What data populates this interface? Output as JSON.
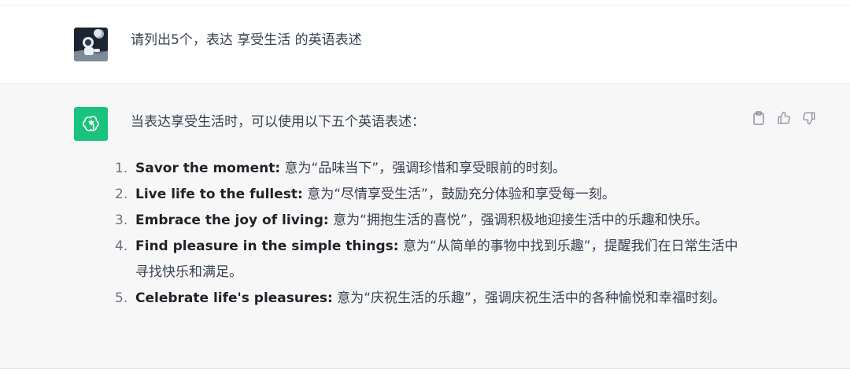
{
  "conversation": {
    "user_message": "请列出5个，表达 享受生活 的英语表述",
    "assistant_intro": "当表达享受生活时，可以使用以下五个英语表述：",
    "answers": [
      {
        "num": "1.",
        "phrase": "Savor the moment:",
        "desc": " 意为“品味当下”，强调珍惜和享受眼前的时刻。"
      },
      {
        "num": "2.",
        "phrase": "Live life to the fullest:",
        "desc": " 意为“尽情享受生活”，鼓励充分体验和享受每一刻。"
      },
      {
        "num": "3.",
        "phrase": "Embrace the joy of living:",
        "desc": " 意为“拥抱生活的喜悦”，强调积极地迎接生活中的乐趣和快乐。"
      },
      {
        "num": "4.",
        "phrase": "Find pleasure in the simple things:",
        "desc": " 意为“从简单的事物中找到乐趣”，提醒我们在日常生活中寻找快乐和满足。"
      },
      {
        "num": "5.",
        "phrase": "Celebrate life's pleasures:",
        "desc": " 意为“庆祝生活的乐趣”，强调庆祝生活中的各种愉悦和幸福时刻。"
      }
    ]
  },
  "icons": {
    "user_avatar": "user-avatar-astronaut",
    "assistant_avatar": "openai-logo-icon",
    "copy": "clipboard-icon",
    "like": "thumbs-up-icon",
    "dislike": "thumbs-down-icon"
  },
  "colors": {
    "assistant_bg": "#f7f7f8",
    "gpt_green": "#19c37d",
    "text": "#374151",
    "icon": "#8e8ea0"
  }
}
